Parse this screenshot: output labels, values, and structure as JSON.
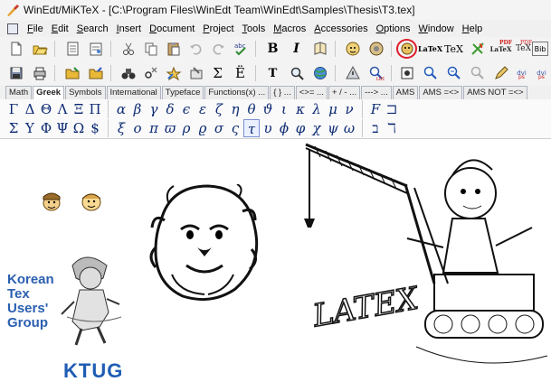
{
  "window": {
    "title": "WinEdt/MiKTeX - [C:\\Program Files\\WinEdt Team\\WinEdt\\Samples\\Thesis\\T3.tex]"
  },
  "menu": [
    "File",
    "Edit",
    "Search",
    "Insert",
    "Document",
    "Project",
    "Tools",
    "Macros",
    "Accessories",
    "Options",
    "Window",
    "Help"
  ],
  "toolbar1": [
    {
      "name": "new-file-icon"
    },
    {
      "name": "open-file-icon"
    },
    {
      "name": "document-icon"
    },
    {
      "name": "document-alt-icon"
    },
    {
      "name": "cut-icon"
    },
    {
      "name": "copy-icon"
    },
    {
      "name": "paste-icon"
    },
    {
      "name": "undo-icon"
    },
    {
      "name": "redo-icon"
    },
    {
      "name": "spell-check-icon"
    },
    {
      "name": "bold-icon",
      "glyph": "B"
    },
    {
      "name": "italic-icon",
      "glyph": "I"
    },
    {
      "name": "book-icon"
    },
    {
      "name": "lion-icon"
    },
    {
      "name": "gear-lion-icon"
    },
    {
      "name": "lion-highlighted-icon"
    },
    {
      "name": "latex-icon",
      "glyph": "LaTeX"
    },
    {
      "name": "tex-icon",
      "glyph": "TeX"
    },
    {
      "name": "aleph-icon"
    },
    {
      "name": "pdflatex-icon",
      "glyph": "LaTeX"
    },
    {
      "name": "pdftex-icon",
      "glyph": "TeX"
    },
    {
      "name": "bibtex-icon",
      "glyph": "Bib"
    }
  ],
  "toolbar2": [
    {
      "name": "save-icon"
    },
    {
      "name": "print-icon"
    },
    {
      "name": "folder-icon"
    },
    {
      "name": "folder-alt-icon"
    },
    {
      "name": "binoculars-icon"
    },
    {
      "name": "find-replace-icon"
    },
    {
      "name": "spelling-icon"
    },
    {
      "name": "tools-icon"
    },
    {
      "name": "sigma-icon",
      "glyph": "Σ"
    },
    {
      "name": "diaeresis-icon",
      "glyph": "Ë"
    },
    {
      "name": "typewriter-icon",
      "glyph": "T"
    },
    {
      "name": "magnifier-icon"
    },
    {
      "name": "globe-icon"
    },
    {
      "name": "warning-icon"
    },
    {
      "name": "log-search-icon"
    },
    {
      "name": "view-icon"
    },
    {
      "name": "dvi-search-icon"
    },
    {
      "name": "search-alt-icon"
    },
    {
      "name": "zoom-icon"
    },
    {
      "name": "pencil-icon"
    },
    {
      "name": "dvi-ps-icon",
      "glyph": "dvi"
    },
    {
      "name": "dvi-pdf-icon",
      "glyph": "dvi"
    }
  ],
  "tabs": [
    "Math",
    "Greek",
    "Symbols",
    "International",
    "Typeface",
    "Functions(x) ...",
    "{ } ...",
    "<>= ...",
    "+ / - ...",
    "---> ...",
    "AMS",
    "AMS =<>",
    "AMS NOT =<>"
  ],
  "active_tab": "Greek",
  "greek_upper_row1": [
    "Γ",
    "Δ",
    "Θ",
    "Λ",
    "Ξ",
    "Π"
  ],
  "greek_upper_row2": [
    "Σ",
    "Υ",
    "Φ",
    "Ψ",
    "Ω",
    "$"
  ],
  "greek_lower_row1": [
    "α",
    "β",
    "γ",
    "δ",
    "ϵ",
    "ε",
    "ζ",
    "η",
    "θ",
    "ϑ",
    "ι",
    "κ",
    "λ",
    "μ",
    "ν"
  ],
  "greek_lower_row2": [
    "ξ",
    "ο",
    "π",
    "ϖ",
    "ρ",
    "ϱ",
    "σ",
    "ς",
    "τ",
    "υ",
    "ϕ",
    "φ",
    "χ",
    "ψ",
    "ω"
  ],
  "misc_row1": [
    "F",
    "⊐"
  ],
  "misc_row2": [
    "ב",
    "ℸ"
  ],
  "ktug": {
    "lines": [
      "Korean",
      "Tex",
      "Users'",
      "Group"
    ],
    "label": "KTUG"
  },
  "crane_text": "LATEX"
}
